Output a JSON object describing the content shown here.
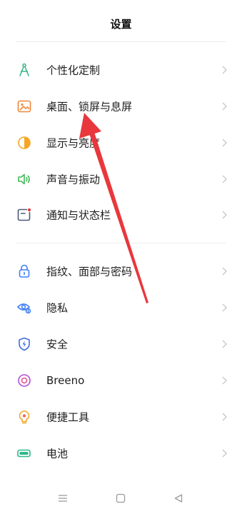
{
  "header": {
    "title": "设置"
  },
  "settings_group_1": [
    {
      "label": "个性化定制",
      "icon": "personalization-compass-icon",
      "color": "#3cb98a"
    },
    {
      "label": "桌面、锁屏与息屏",
      "icon": "wallpaper-icon",
      "color": "#f0873a"
    },
    {
      "label": "显示与亮度",
      "icon": "brightness-icon",
      "color": "#f5a623"
    },
    {
      "label": "声音与振动",
      "icon": "sound-vibration-icon",
      "color": "#41b856"
    },
    {
      "label": "通知与状态栏",
      "icon": "notification-icon",
      "color": "#4a5a7a"
    }
  ],
  "settings_group_2": [
    {
      "label": "指纹、面部与密码",
      "icon": "lock-icon",
      "color": "#3f7ff5"
    },
    {
      "label": "隐私",
      "icon": "privacy-eye-icon",
      "color": "#3f7ff5"
    },
    {
      "label": "安全",
      "icon": "security-shield-icon",
      "color": "#3f6fe0"
    },
    {
      "label": "Breeno",
      "icon": "breeno-icon",
      "color": "#b14fd6"
    },
    {
      "label": "便捷工具",
      "icon": "convenience-tools-icon",
      "color": "#f0a830"
    },
    {
      "label": "电池",
      "icon": "battery-icon",
      "color": "#2fb88a"
    }
  ],
  "annotation": {
    "arrow_color": "#e8383d"
  }
}
